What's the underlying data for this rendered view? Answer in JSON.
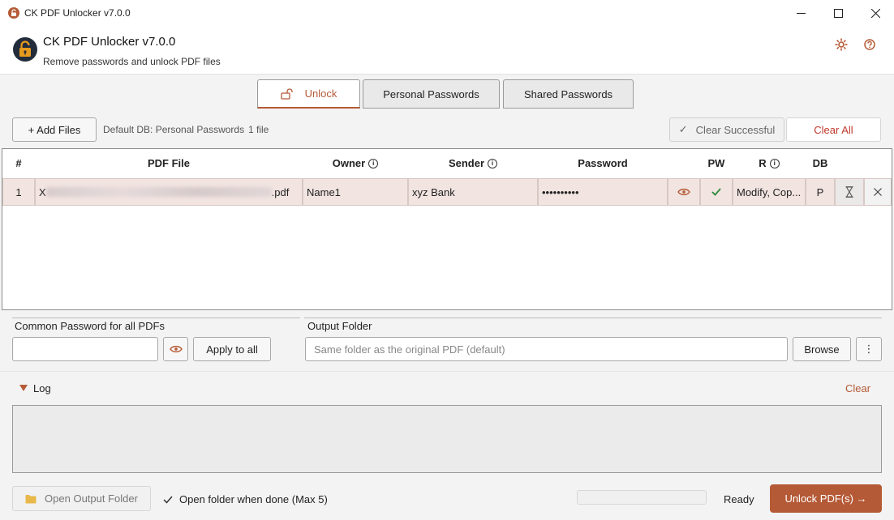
{
  "window": {
    "title": "CK PDF Unlocker  v7.0.0"
  },
  "header": {
    "app_name": "CK PDF Unlocker  v7.0.0",
    "subtitle": "Remove passwords and unlock PDF files",
    "icons": [
      "lock-logo-icon",
      "settings-gear-icon",
      "help-icon"
    ]
  },
  "tabs": [
    {
      "label": "Unlock",
      "active": true
    },
    {
      "label": "Personal Passwords",
      "active": false
    },
    {
      "label": "Shared Passwords",
      "active": false
    }
  ],
  "toolbar": {
    "add_files": "+ Add Files",
    "default_db": "Default DB: Personal Passwords",
    "file_count": "1 file",
    "clear_successful": "Clear Successful",
    "clear_all": "Clear All"
  },
  "table": {
    "headers": {
      "num": "#",
      "file": "PDF File",
      "owner": "Owner",
      "sender": "Sender",
      "password": "Password",
      "pw": "PW",
      "r": "R",
      "db": "DB"
    },
    "rows": [
      {
        "num": "1",
        "file_prefix": "X",
        "file_suffix": ".pdf",
        "owner": "Name1",
        "sender": "xyz Bank",
        "password": "••••••••••",
        "r": "Modify, Cop...",
        "db": "P"
      }
    ]
  },
  "common_password": {
    "title": "Common Password for all PDFs",
    "value": "",
    "apply_label": "Apply to all"
  },
  "output_folder": {
    "title": "Output Folder",
    "placeholder": "Same folder as the original PDF (default)",
    "browse_label": "Browse",
    "more_label": "⋮"
  },
  "log": {
    "title": "Log",
    "clear_label": "Clear"
  },
  "footer": {
    "open_output_folder": "Open Output Folder",
    "open_when_done": "Open folder when done (Max 5)",
    "open_when_done_checked": true,
    "progress": 0,
    "status": "Ready",
    "unlock_button": "Unlock PDF(s) →"
  },
  "colors": {
    "accent": "#b55a36",
    "row_bg": "#f1e4e1",
    "folder_icon": "#e8b84a",
    "check_green": "#2e8b3a"
  }
}
